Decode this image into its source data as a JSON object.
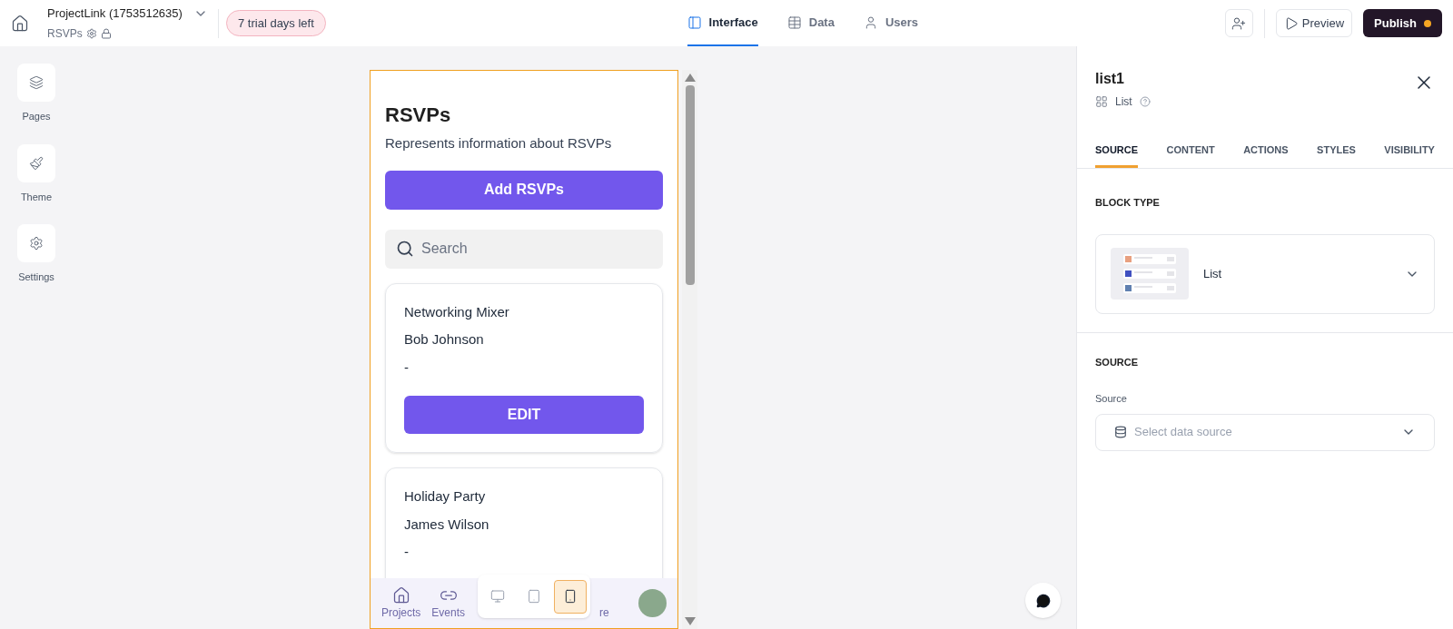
{
  "header": {
    "project": "ProjectLink (1753512635)",
    "page": "RSVPs",
    "trial_badge": "7 trial days left",
    "tabs": [
      {
        "label": "Interface",
        "selected": true
      },
      {
        "label": "Data",
        "selected": false
      },
      {
        "label": "Users",
        "selected": false
      }
    ],
    "preview": "Preview",
    "publish": "Publish"
  },
  "sidebar": [
    {
      "label": "Pages"
    },
    {
      "label": "Theme"
    },
    {
      "label": "Settings"
    }
  ],
  "preview": {
    "title": "RSVPs",
    "subtitle": "Represents information about RSVPs",
    "add_button": "Add RSVPs",
    "search": {
      "placeholder": "Search"
    },
    "cards": [
      {
        "event": "Networking Mixer",
        "name": "Bob Johnson",
        "note": "-",
        "button": "EDIT"
      },
      {
        "event": "Holiday Party",
        "name": "James Wilson",
        "note": "-"
      }
    ],
    "nav": [
      {
        "label": "Projects"
      },
      {
        "label": "Events"
      },
      {
        "label": "re"
      }
    ],
    "devices": [
      {
        "kind": "desktop",
        "selected": false
      },
      {
        "kind": "tablet",
        "selected": false
      },
      {
        "kind": "phone",
        "selected": true
      }
    ]
  },
  "panel": {
    "title": "list1",
    "type": "List",
    "tabs": [
      {
        "label": "SOURCE",
        "selected": true
      },
      {
        "label": "CONTENT",
        "selected": false
      },
      {
        "label": "ACTIONS",
        "selected": false
      },
      {
        "label": "STYLES",
        "selected": false
      },
      {
        "label": "VISIBILITY",
        "selected": false
      }
    ],
    "block_type": {
      "heading": "BLOCK TYPE",
      "value": "List"
    },
    "source": {
      "heading": "SOURCE",
      "label": "Source",
      "placeholder": "Select data source"
    }
  }
}
